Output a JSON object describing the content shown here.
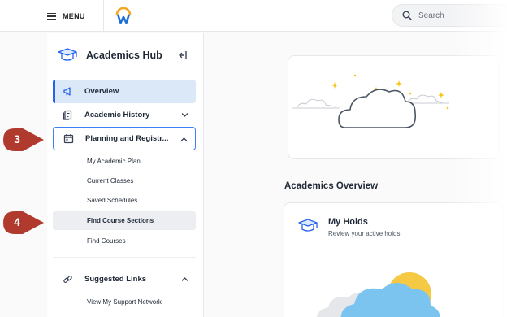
{
  "topbar": {
    "menu_label": "MENU",
    "search_placeholder": "Search"
  },
  "sidebar": {
    "hub_title": "Academics Hub",
    "nav": [
      {
        "label": "Overview",
        "icon": "megaphone-icon",
        "active": true
      },
      {
        "label": "Academic History",
        "icon": "history-document-icon",
        "expanded": false
      },
      {
        "label": "Planning and Registr...",
        "icon": "calendar-icon",
        "expanded": true
      }
    ],
    "planning_items": [
      "My Academic Plan",
      "Current Classes",
      "Saved Schedules",
      "Find Course Sections",
      "Find Courses"
    ],
    "selected_item": "Find Course Sections",
    "suggested_links": {
      "label": "Suggested Links",
      "icon": "link-icon",
      "expanded": true,
      "items": [
        "View My Support Network"
      ]
    }
  },
  "main": {
    "section_heading": "Academics Overview",
    "holds_card": {
      "title": "My Holds",
      "subtitle": "Review your active holds"
    }
  },
  "callouts": [
    "3",
    "4"
  ],
  "colors": {
    "accent": "#2563eb",
    "active_bg": "#dbe8f7",
    "callout": "#b03a2e",
    "logo_blue": "#1e6fd9",
    "logo_orange": "#f5a623"
  }
}
